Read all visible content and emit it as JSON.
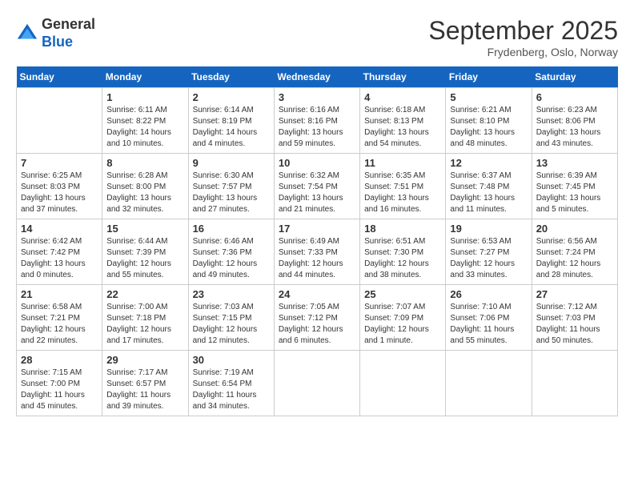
{
  "header": {
    "logo_general": "General",
    "logo_blue": "Blue",
    "month_title": "September 2025",
    "location": "Frydenberg, Oslo, Norway"
  },
  "weekdays": [
    "Sunday",
    "Monday",
    "Tuesday",
    "Wednesday",
    "Thursday",
    "Friday",
    "Saturday"
  ],
  "weeks": [
    [
      {
        "day": "",
        "sunrise": "",
        "sunset": "",
        "daylight": ""
      },
      {
        "day": "1",
        "sunrise": "Sunrise: 6:11 AM",
        "sunset": "Sunset: 8:22 PM",
        "daylight": "Daylight: 14 hours and 10 minutes."
      },
      {
        "day": "2",
        "sunrise": "Sunrise: 6:14 AM",
        "sunset": "Sunset: 8:19 PM",
        "daylight": "Daylight: 14 hours and 4 minutes."
      },
      {
        "day": "3",
        "sunrise": "Sunrise: 6:16 AM",
        "sunset": "Sunset: 8:16 PM",
        "daylight": "Daylight: 13 hours and 59 minutes."
      },
      {
        "day": "4",
        "sunrise": "Sunrise: 6:18 AM",
        "sunset": "Sunset: 8:13 PM",
        "daylight": "Daylight: 13 hours and 54 minutes."
      },
      {
        "day": "5",
        "sunrise": "Sunrise: 6:21 AM",
        "sunset": "Sunset: 8:10 PM",
        "daylight": "Daylight: 13 hours and 48 minutes."
      },
      {
        "day": "6",
        "sunrise": "Sunrise: 6:23 AM",
        "sunset": "Sunset: 8:06 PM",
        "daylight": "Daylight: 13 hours and 43 minutes."
      }
    ],
    [
      {
        "day": "7",
        "sunrise": "Sunrise: 6:25 AM",
        "sunset": "Sunset: 8:03 PM",
        "daylight": "Daylight: 13 hours and 37 minutes."
      },
      {
        "day": "8",
        "sunrise": "Sunrise: 6:28 AM",
        "sunset": "Sunset: 8:00 PM",
        "daylight": "Daylight: 13 hours and 32 minutes."
      },
      {
        "day": "9",
        "sunrise": "Sunrise: 6:30 AM",
        "sunset": "Sunset: 7:57 PM",
        "daylight": "Daylight: 13 hours and 27 minutes."
      },
      {
        "day": "10",
        "sunrise": "Sunrise: 6:32 AM",
        "sunset": "Sunset: 7:54 PM",
        "daylight": "Daylight: 13 hours and 21 minutes."
      },
      {
        "day": "11",
        "sunrise": "Sunrise: 6:35 AM",
        "sunset": "Sunset: 7:51 PM",
        "daylight": "Daylight: 13 hours and 16 minutes."
      },
      {
        "day": "12",
        "sunrise": "Sunrise: 6:37 AM",
        "sunset": "Sunset: 7:48 PM",
        "daylight": "Daylight: 13 hours and 11 minutes."
      },
      {
        "day": "13",
        "sunrise": "Sunrise: 6:39 AM",
        "sunset": "Sunset: 7:45 PM",
        "daylight": "Daylight: 13 hours and 5 minutes."
      }
    ],
    [
      {
        "day": "14",
        "sunrise": "Sunrise: 6:42 AM",
        "sunset": "Sunset: 7:42 PM",
        "daylight": "Daylight: 13 hours and 0 minutes."
      },
      {
        "day": "15",
        "sunrise": "Sunrise: 6:44 AM",
        "sunset": "Sunset: 7:39 PM",
        "daylight": "Daylight: 12 hours and 55 minutes."
      },
      {
        "day": "16",
        "sunrise": "Sunrise: 6:46 AM",
        "sunset": "Sunset: 7:36 PM",
        "daylight": "Daylight: 12 hours and 49 minutes."
      },
      {
        "day": "17",
        "sunrise": "Sunrise: 6:49 AM",
        "sunset": "Sunset: 7:33 PM",
        "daylight": "Daylight: 12 hours and 44 minutes."
      },
      {
        "day": "18",
        "sunrise": "Sunrise: 6:51 AM",
        "sunset": "Sunset: 7:30 PM",
        "daylight": "Daylight: 12 hours and 38 minutes."
      },
      {
        "day": "19",
        "sunrise": "Sunrise: 6:53 AM",
        "sunset": "Sunset: 7:27 PM",
        "daylight": "Daylight: 12 hours and 33 minutes."
      },
      {
        "day": "20",
        "sunrise": "Sunrise: 6:56 AM",
        "sunset": "Sunset: 7:24 PM",
        "daylight": "Daylight: 12 hours and 28 minutes."
      }
    ],
    [
      {
        "day": "21",
        "sunrise": "Sunrise: 6:58 AM",
        "sunset": "Sunset: 7:21 PM",
        "daylight": "Daylight: 12 hours and 22 minutes."
      },
      {
        "day": "22",
        "sunrise": "Sunrise: 7:00 AM",
        "sunset": "Sunset: 7:18 PM",
        "daylight": "Daylight: 12 hours and 17 minutes."
      },
      {
        "day": "23",
        "sunrise": "Sunrise: 7:03 AM",
        "sunset": "Sunset: 7:15 PM",
        "daylight": "Daylight: 12 hours and 12 minutes."
      },
      {
        "day": "24",
        "sunrise": "Sunrise: 7:05 AM",
        "sunset": "Sunset: 7:12 PM",
        "daylight": "Daylight: 12 hours and 6 minutes."
      },
      {
        "day": "25",
        "sunrise": "Sunrise: 7:07 AM",
        "sunset": "Sunset: 7:09 PM",
        "daylight": "Daylight: 12 hours and 1 minute."
      },
      {
        "day": "26",
        "sunrise": "Sunrise: 7:10 AM",
        "sunset": "Sunset: 7:06 PM",
        "daylight": "Daylight: 11 hours and 55 minutes."
      },
      {
        "day": "27",
        "sunrise": "Sunrise: 7:12 AM",
        "sunset": "Sunset: 7:03 PM",
        "daylight": "Daylight: 11 hours and 50 minutes."
      }
    ],
    [
      {
        "day": "28",
        "sunrise": "Sunrise: 7:15 AM",
        "sunset": "Sunset: 7:00 PM",
        "daylight": "Daylight: 11 hours and 45 minutes."
      },
      {
        "day": "29",
        "sunrise": "Sunrise: 7:17 AM",
        "sunset": "Sunset: 6:57 PM",
        "daylight": "Daylight: 11 hours and 39 minutes."
      },
      {
        "day": "30",
        "sunrise": "Sunrise: 7:19 AM",
        "sunset": "Sunset: 6:54 PM",
        "daylight": "Daylight: 11 hours and 34 minutes."
      },
      {
        "day": "",
        "sunrise": "",
        "sunset": "",
        "daylight": ""
      },
      {
        "day": "",
        "sunrise": "",
        "sunset": "",
        "daylight": ""
      },
      {
        "day": "",
        "sunrise": "",
        "sunset": "",
        "daylight": ""
      },
      {
        "day": "",
        "sunrise": "",
        "sunset": "",
        "daylight": ""
      }
    ]
  ]
}
